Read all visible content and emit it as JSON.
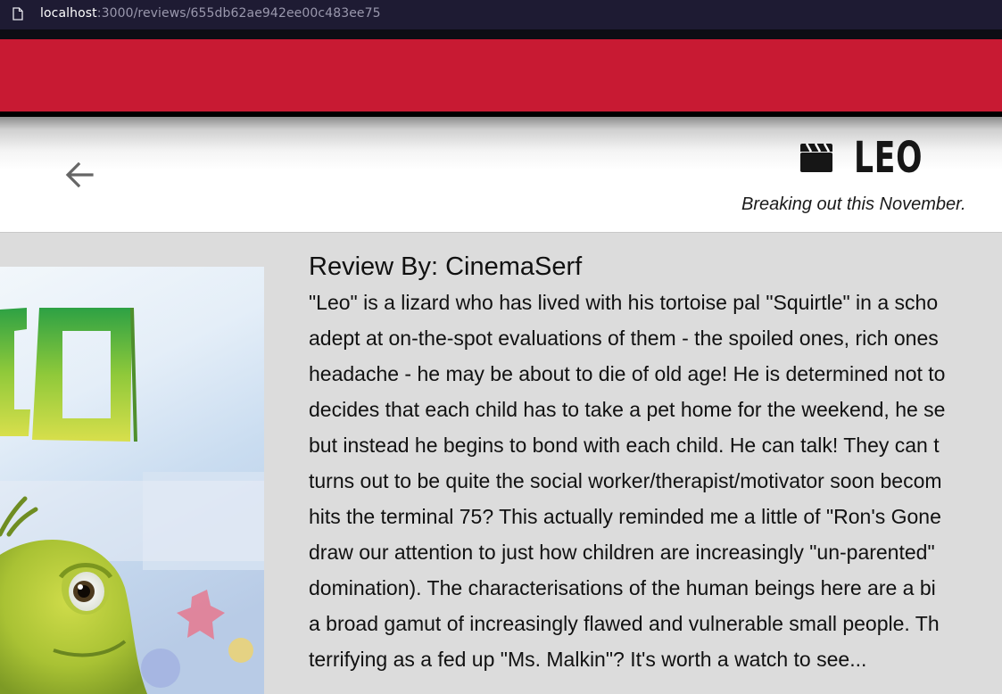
{
  "browser": {
    "url_host": "localhost",
    "url_rest": ":3000/reviews/655db62ae942ee00c483ee75"
  },
  "movie": {
    "title": "LEO",
    "tagline": "Breaking out this November."
  },
  "review": {
    "heading": "Review By: CinemaSerf",
    "lines": [
      "\"Leo\" is a lizard who has lived with his tortoise pal \"Squirtle\" in a scho",
      "adept at on-the-spot evaluations of them - the spoiled ones, rich ones",
      "headache - he may be about to die of old age! He is determined not to",
      "decides that each child has to take a pet home for the weekend, he se",
      "but instead he begins to bond with each child. He can talk! They can t",
      "turns out to be quite the social worker/therapist/motivator soon becom",
      "hits the terminal 75? This actually reminded me a little of \"Ron's Gone",
      "draw our attention to just how children are increasingly \"un-parented\"",
      "domination). The characterisations of the human beings here are a bi",
      "a broad gamut of increasingly flawed and vulnerable small people. Th",
      "terrifying as a fed up \"Ms. Malkin\"? It's worth a watch to see..."
    ]
  },
  "icons": {
    "page": "page-icon",
    "back": "arrow-left-icon",
    "movie": "clapperboard-icon"
  },
  "colors": {
    "browser_bar": "#1e1b33",
    "banner": "#c81a33",
    "content_bg": "#dcdcdc"
  }
}
